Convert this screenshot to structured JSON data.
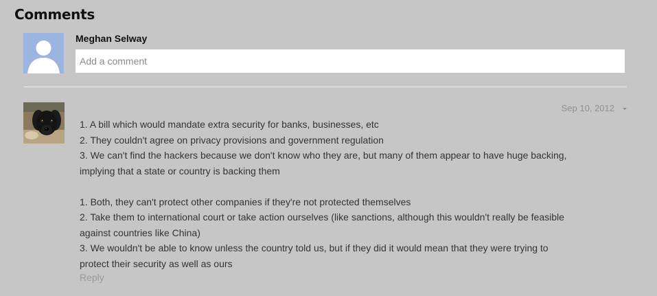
{
  "section": {
    "title": "Comments"
  },
  "new_comment": {
    "author": "Meghan Selway",
    "placeholder": "Add a comment",
    "avatar_icon": "default-user-avatar-icon"
  },
  "comments": [
    {
      "avatar_icon": "black-dog-avatar-photo",
      "date": "Sep 10, 2012",
      "menu_icon": "caret-down-icon",
      "lines": [
        "1. A bill which would mandate extra security for banks, businesses, etc",
        "2. They couldn't agree on privacy provisions and government regulation",
        "3. We can't find the hackers because we don't know who they are, but many of them appear to have huge backing,",
        "implying that a state or country is backing them",
        "",
        "1. Both, they can't protect other companies if they're not protected themselves",
        "2. Take them to international court or take action ourselves (like sanctions, although this wouldn't really be feasible",
        "against countries like China)",
        "3. We wouldn't be able to know unless the country told us, but if they did it would mean that they were trying to",
        "protect their security as well as ours"
      ],
      "reply_label": "Reply"
    }
  ],
  "colors": {
    "background": "#c6c6c6",
    "avatar_default": "#9db4e1",
    "text": "#333333",
    "muted_text": "#999999",
    "divider": "#ececec"
  }
}
